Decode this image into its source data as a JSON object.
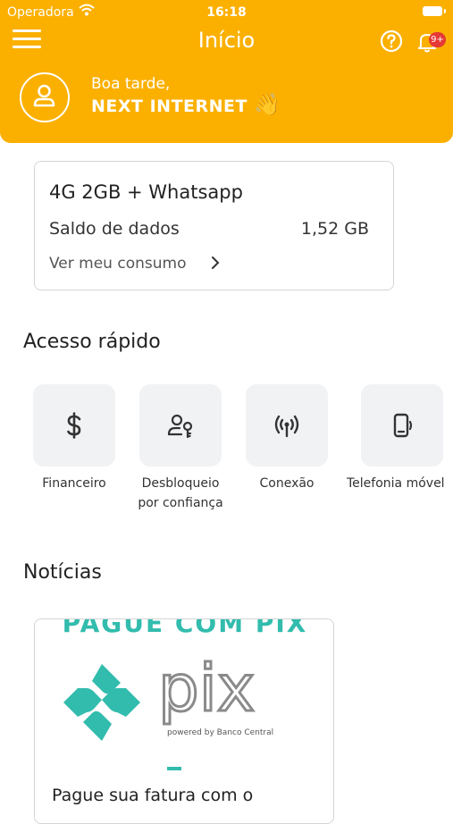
{
  "status_bar": {
    "carrier": "Operadora",
    "time": "16:18"
  },
  "header": {
    "title": "Início",
    "notifications_badge": "9+",
    "greeting": "Boa tarde,",
    "user_name": "NEXT INTERNET",
    "wave_emoji": "👋",
    "icons": [
      "menu-icon",
      "help-icon",
      "bell-icon",
      "user-icon"
    ]
  },
  "plan": {
    "name": "4G 2GB + Whatsapp",
    "balance_label": "Saldo de dados",
    "balance_value": "1,52 GB",
    "consumption_link": "Ver meu consumo"
  },
  "quick_access": {
    "title": "Acesso rápido",
    "items": [
      {
        "label": "Financeiro",
        "icon": "dollar-icon"
      },
      {
        "label_line1": "Desbloqueio",
        "label_line2": "por confiança",
        "icon": "user-key-icon"
      },
      {
        "label": "Conexão",
        "icon": "antenna-icon"
      },
      {
        "label": "Telefonia móvel",
        "icon": "mobile-phone-icon"
      }
    ]
  },
  "news": {
    "title": "Notícias",
    "card": {
      "banner_heading": "PAGUE COM PIX",
      "logo_text": "pix",
      "logo_powered": "powered by Banco Central",
      "headline": "Pague sua fatura com o"
    }
  },
  "colors": {
    "brand": "#FBB000",
    "pix": "#32BCAD",
    "badge": "#E53935"
  }
}
